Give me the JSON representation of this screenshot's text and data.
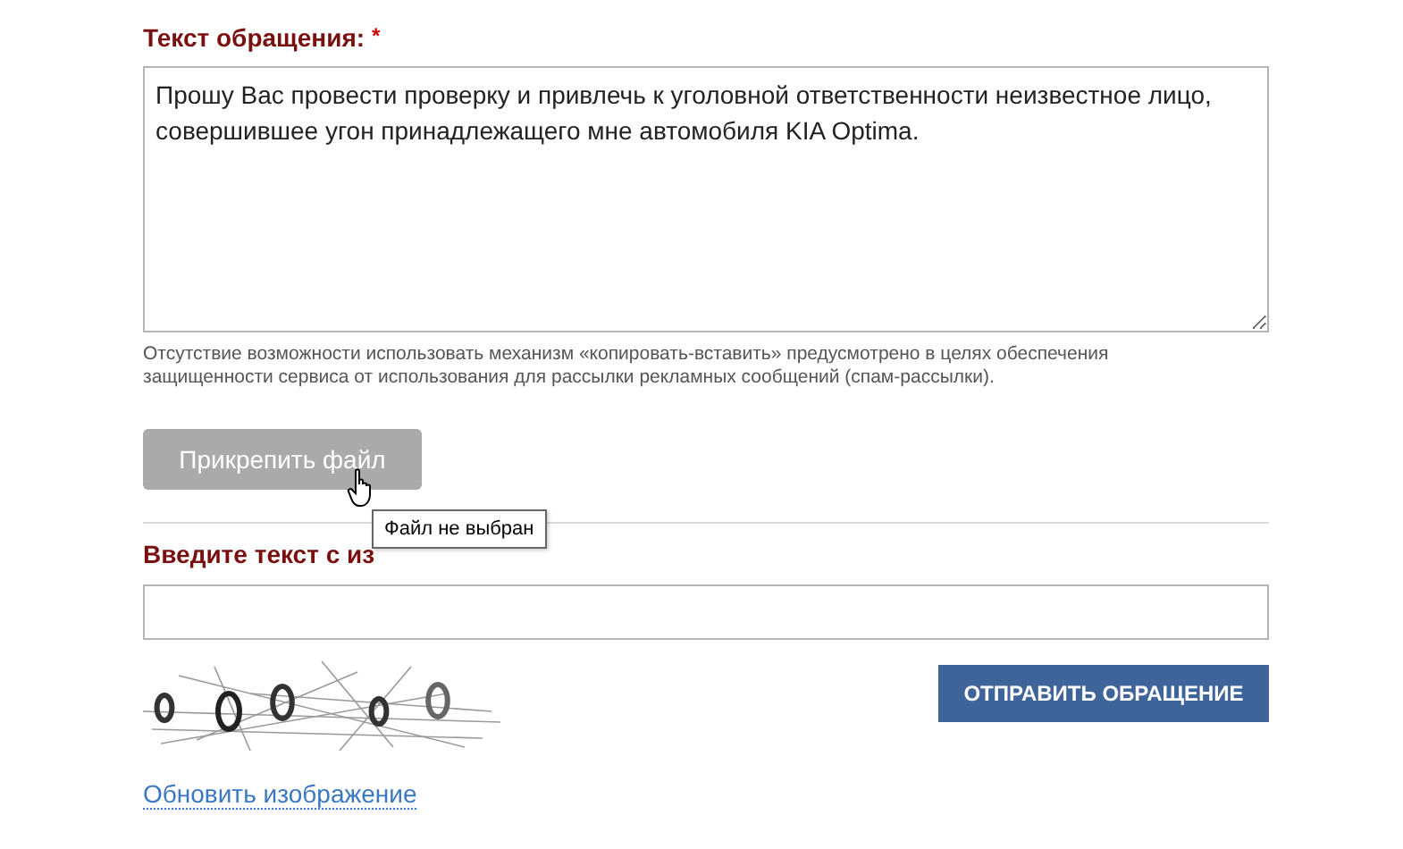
{
  "message": {
    "label": "Текст обращения:",
    "required_mark": "*",
    "value": "Прошу Вас провести проверку и привлечь к уголовной ответственности неизвестное лицо, совершившее угон принадлежащего мне автомобиля KIA Optima."
  },
  "hint": "Отсутствие возможности использовать механизм «копировать-вставить» предусмотрено в целях обеспечения защищенности сервиса от использования для рассылки рекламных сообщений (спам-рассылки).",
  "attach_button": {
    "label": "Прикрепить файл"
  },
  "tooltip": "Файл не выбран",
  "captcha": {
    "label": "Введите текст с из",
    "refresh_link": "Обновить изображение"
  },
  "submit_button": "ОТПРАВИТЬ ОБРАЩЕНИЕ"
}
